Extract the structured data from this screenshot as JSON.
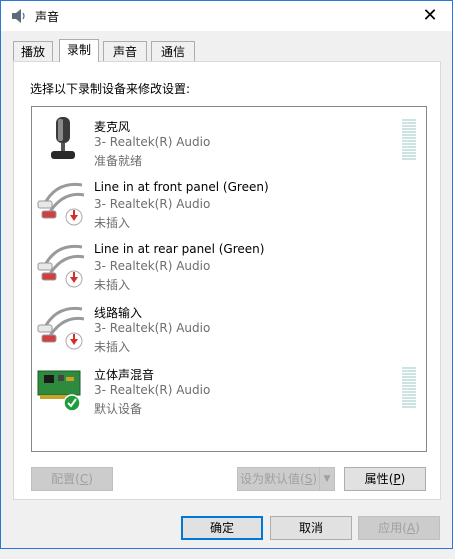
{
  "window": {
    "title": "声音",
    "close_glyph": "✕"
  },
  "tabs": [
    {
      "label": "播放",
      "active": false
    },
    {
      "label": "录制",
      "active": true
    },
    {
      "label": "声音",
      "active": false
    },
    {
      "label": "通信",
      "active": false
    }
  ],
  "panel": {
    "prompt": "选择以下录制设备来修改设置:"
  },
  "devices": [
    {
      "name": "麦克风",
      "driver": "3- Realtek(R) Audio",
      "status": "准备就绪",
      "icon": "microphone-icon",
      "badge": "",
      "meter": true
    },
    {
      "name": "Line in at front panel (Green)",
      "driver": "3- Realtek(R) Audio",
      "status": "未插入",
      "icon": "rca-cable-icon",
      "badge": "unplugged-arrow-icon",
      "meter": false
    },
    {
      "name": "Line in at rear panel (Green)",
      "driver": "3- Realtek(R) Audio",
      "status": "未插入",
      "icon": "rca-cable-icon",
      "badge": "unplugged-arrow-icon",
      "meter": false
    },
    {
      "name": "线路输入",
      "driver": "3- Realtek(R) Audio",
      "status": "未插入",
      "icon": "rca-cable-icon",
      "badge": "unplugged-arrow-icon",
      "meter": false
    },
    {
      "name": "立体声混音",
      "driver": "3- Realtek(R) Audio",
      "status": "默认设备",
      "icon": "sound-card-icon",
      "badge": "default-check-icon",
      "meter": true
    }
  ],
  "buttons": {
    "configure": {
      "label": "配置",
      "key": "C"
    },
    "set_default": {
      "label": "设为默认值",
      "key": "S"
    },
    "properties": {
      "label": "属性",
      "key": "P"
    },
    "ok": "确定",
    "cancel": "取消",
    "apply": {
      "label": "应用",
      "key": "A"
    }
  },
  "colors": {
    "accent": "#0078d7",
    "badge_red": "#d32f2f",
    "badge_green": "#1e9e3a"
  }
}
